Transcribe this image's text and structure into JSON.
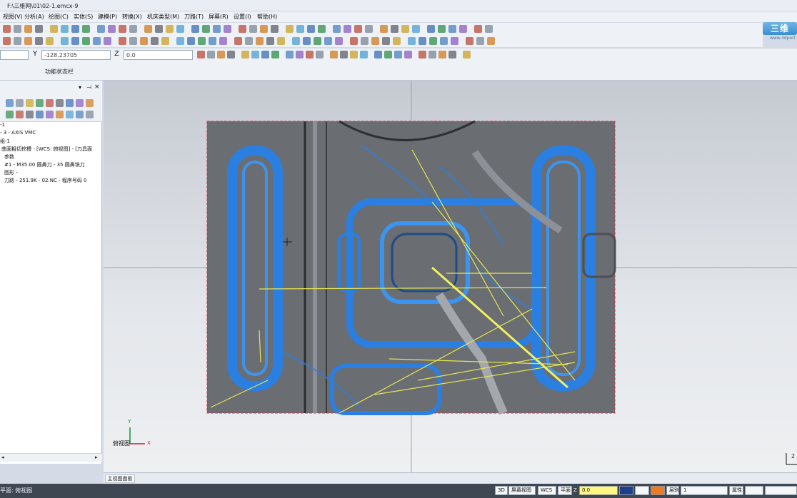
{
  "app": {
    "window_title": "F:\\三维网\\01\\02-1.emcx-9",
    "menu": [
      "视图(V)",
      "分析(A)",
      "绘图(C)",
      "实体(S)",
      "建模(P)",
      "转换(X)",
      "机床类型(M)",
      "刀路(T)",
      "屏幕(R)",
      "设置(I)",
      "帮助(H)"
    ],
    "logo_text": "三维",
    "logo_subtext": "www.3dport"
  },
  "coords": {
    "y_label": "Y",
    "y_value": "-128.23705",
    "z_label": "Z",
    "z_value": "0.0"
  },
  "ribbon": {
    "label": "功能状态栏"
  },
  "operations_tree": {
    "items": [
      "-1",
      "- 3 - AXIS VMC",
      "组-1",
      "曲面粗切挖槽 - [WCS: 俯视图] - [刀具面",
      "参数",
      "#1 - M35.00 圆鼻刀 - 35 圆鼻铣刀",
      "图形 -",
      "刀路 - 251.9K - 02.NC - 程序号码 0"
    ]
  },
  "viewport": {
    "view_name": "俯视图",
    "axis_x": "X",
    "axis_y": "Y",
    "scale_text": "2"
  },
  "tabstrip": {
    "tab": "主视图面板"
  },
  "statusbar": {
    "plane": "平面: 俯视图",
    "btn_3d": "3D",
    "screen_view": "屏幕视图",
    "wcs": "WCS",
    "plane_label": "平面",
    "z_label": "Z",
    "z_value": "0.0",
    "layer_label": "层别",
    "layer_value": "1",
    "attr_label": "属性"
  },
  "colors": {
    "toolpath_blue": "#2a7fe0",
    "rapid_yellow": "#e6e650",
    "stock_gray": "#6a6d72",
    "boundary_red": "#d8304a"
  }
}
